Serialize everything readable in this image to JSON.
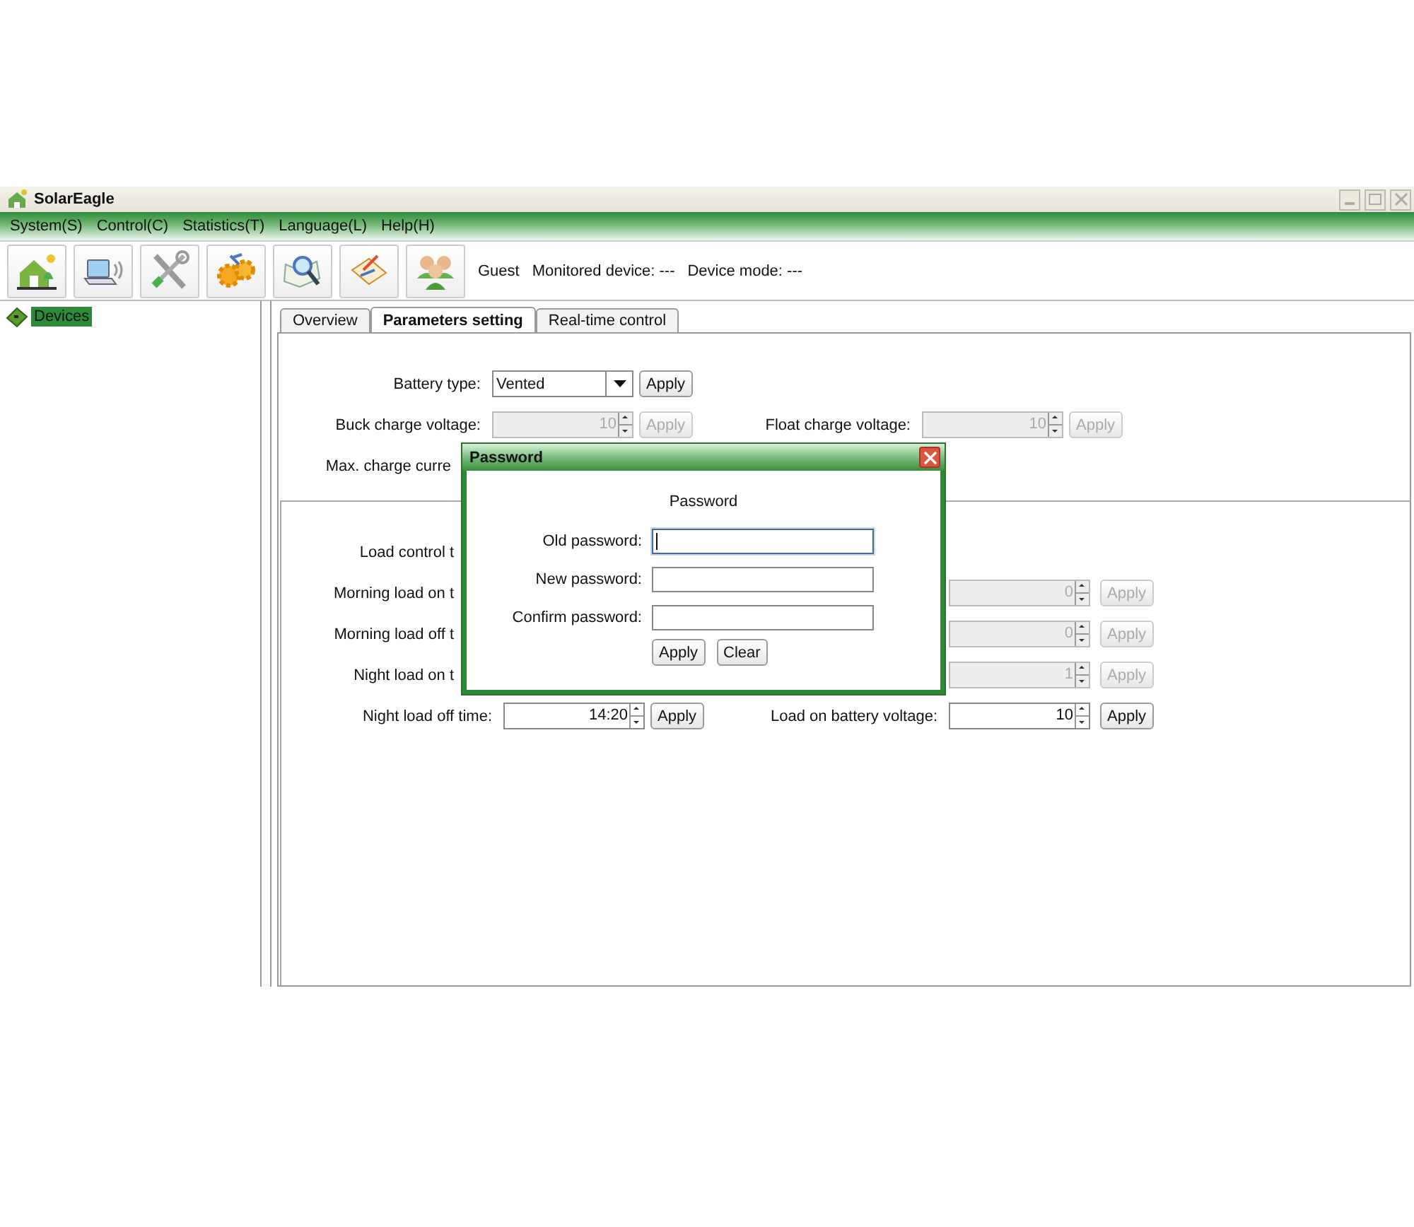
{
  "window": {
    "title": "SolarEagle"
  },
  "menu": [
    "System(S)",
    "Control(C)",
    "Statistics(T)",
    "Language(L)",
    "Help(H)"
  ],
  "status_texts": [
    "Guest",
    "Monitored device: ---",
    "Device mode: ---"
  ],
  "tree": [
    {
      "label": "Devices",
      "selected": true
    }
  ],
  "tabs": [
    {
      "label": "Overview",
      "selected": false
    },
    {
      "label": "Parameters setting",
      "selected": true
    },
    {
      "label": "Real-time control",
      "selected": false
    }
  ],
  "top_rows": [
    {
      "left": {
        "label": "Battery type:",
        "kind": "dropdown",
        "value": "Vented",
        "button": "Apply",
        "disabled": false
      }
    },
    {
      "left": {
        "label": "Buck charge voltage:",
        "kind": "spinner",
        "value": "10",
        "button": "Apply",
        "disabled": true
      },
      "right": {
        "label": "Float charge voltage:",
        "kind": "spinner",
        "value": "10",
        "button": "Apply",
        "disabled": true
      }
    },
    {
      "left": {
        "label": "Max. charge curre",
        "kind": "label"
      }
    }
  ],
  "bottom_rows": [
    {
      "left": {
        "label": "Load control t",
        "kind": "label"
      }
    },
    {
      "left": {
        "label": "Morning load on t",
        "kind": "label"
      },
      "right": {
        "kind": "spinner",
        "value": "0",
        "button": "Apply",
        "disabled": true
      }
    },
    {
      "left": {
        "label": "Morning load off t",
        "kind": "label"
      },
      "right": {
        "kind": "spinner",
        "value": "0",
        "button": "Apply",
        "disabled": true
      }
    },
    {
      "left": {
        "label": "Night load on t",
        "kind": "label"
      },
      "right": {
        "kind": "spinner",
        "value": "1",
        "button": "Apply",
        "disabled": true
      }
    },
    {
      "left": {
        "label": "Night load off time:",
        "kind": "spinner",
        "value": "14:20",
        "button": "Apply",
        "disabled": false
      },
      "right": {
        "label": "Load on battery voltage:",
        "kind": "spinner",
        "value": "10",
        "button": "Apply",
        "disabled": false
      }
    }
  ],
  "dialog": {
    "title": "Password",
    "heading": "Password",
    "fields": [
      {
        "label": "Old password:",
        "focused": true
      },
      {
        "label": "New password:",
        "focused": false
      },
      {
        "label": "Confirm password:",
        "focused": false
      }
    ],
    "buttons": [
      "Apply",
      "Clear"
    ]
  }
}
